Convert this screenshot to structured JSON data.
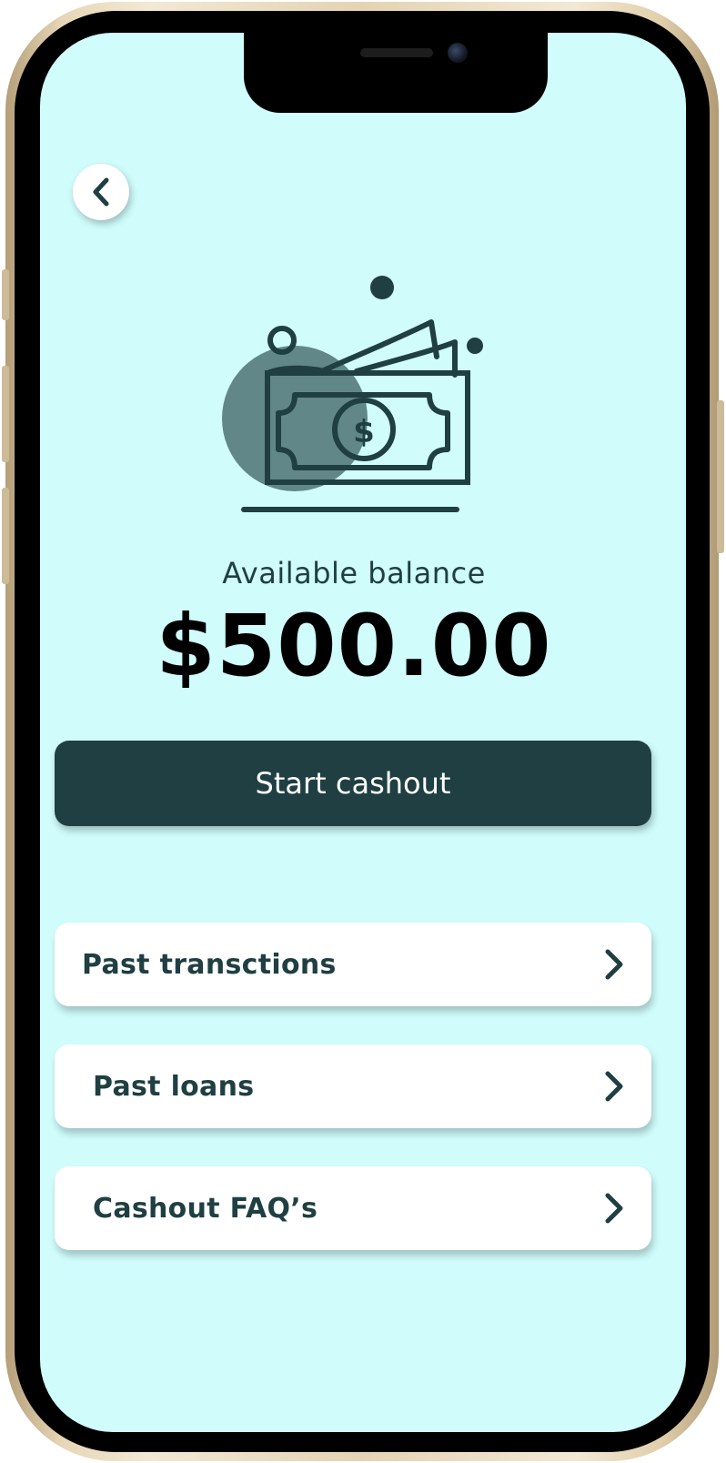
{
  "balance": {
    "label": "Available balance",
    "amount": "$500.00"
  },
  "actions": {
    "cashout_label": "Start cashout"
  },
  "menu": {
    "items": [
      {
        "label": "Past transctions",
        "icon": "chevron-right-icon"
      },
      {
        "label": "Past loans",
        "icon": "chevron-right-icon"
      },
      {
        "label": "Cashout FAQ’s",
        "icon": "chevron-right-icon"
      }
    ]
  },
  "icons": {
    "back": "chevron-left-icon",
    "hero": "money-cash-icon"
  },
  "colors": {
    "screen_background": "#d0fcfc",
    "primary": "#1f3f42",
    "card": "#ffffff",
    "amount_text": "#000000"
  }
}
